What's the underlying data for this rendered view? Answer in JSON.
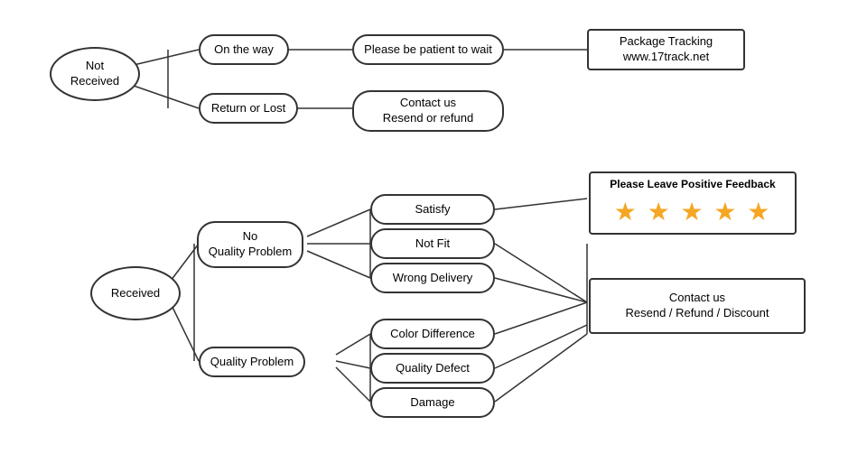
{
  "nodes": {
    "not_received": {
      "label": "Not\nReceived"
    },
    "on_the_way": {
      "label": "On the way"
    },
    "return_or_lost": {
      "label": "Return or Lost"
    },
    "be_patient": {
      "label": "Please be patient to wait"
    },
    "contact_resend": {
      "label": "Contact us\nResend or refund"
    },
    "package_tracking": {
      "label": "Package Tracking\nwww.17track.net"
    },
    "received": {
      "label": "Received"
    },
    "no_quality_problem": {
      "label": "No\nQuality Problem"
    },
    "quality_problem": {
      "label": "Quality Problem"
    },
    "satisfy": {
      "label": "Satisfy"
    },
    "not_fit": {
      "label": "Not Fit"
    },
    "wrong_delivery": {
      "label": "Wrong Delivery"
    },
    "color_difference": {
      "label": "Color Difference"
    },
    "quality_defect": {
      "label": "Quality Defect"
    },
    "damage": {
      "label": "Damage"
    },
    "feedback": {
      "label": "Please Leave Positive Feedback",
      "stars": "★ ★ ★ ★ ★"
    },
    "contact_resend2": {
      "label": "Contact us\nResend / Refund / Discount"
    }
  }
}
